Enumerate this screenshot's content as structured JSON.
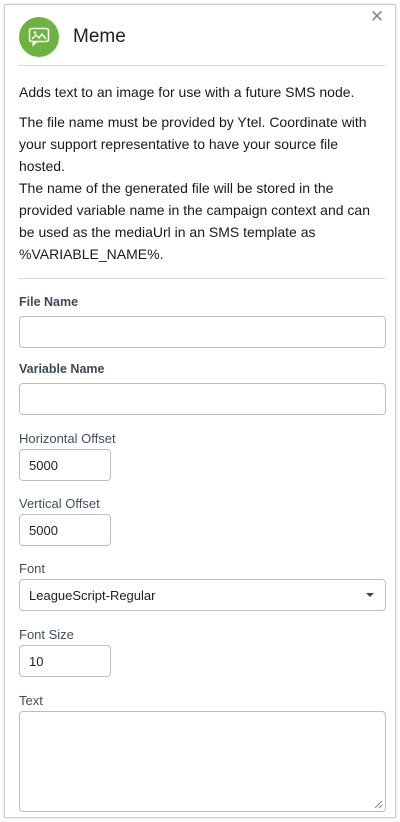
{
  "node": {
    "title": "Meme",
    "icon": "image-message-icon",
    "accent_color": "#6cb33f"
  },
  "description": {
    "line1": "Adds text to an image for use with a future SMS node.",
    "line2": "The file name must be provided by Ytel. Coordinate with your support representative to have your source file hosted.",
    "line3": "The name of the generated file will be stored in the provided variable name in the campaign context and can be used as the mediaUrl in an SMS template as %VARIABLE_NAME%."
  },
  "fields": {
    "file_name": {
      "label": "File Name",
      "value": ""
    },
    "variable_name": {
      "label": "Variable Name",
      "value": ""
    },
    "horizontal_offset": {
      "label": "Horizontal Offset",
      "value": "5000"
    },
    "vertical_offset": {
      "label": "Vertical Offset",
      "value": "5000"
    },
    "font": {
      "label": "Font",
      "value": "LeagueScript-Regular"
    },
    "font_size": {
      "label": "Font Size",
      "value": "10"
    },
    "text": {
      "label": "Text",
      "value": ""
    }
  }
}
